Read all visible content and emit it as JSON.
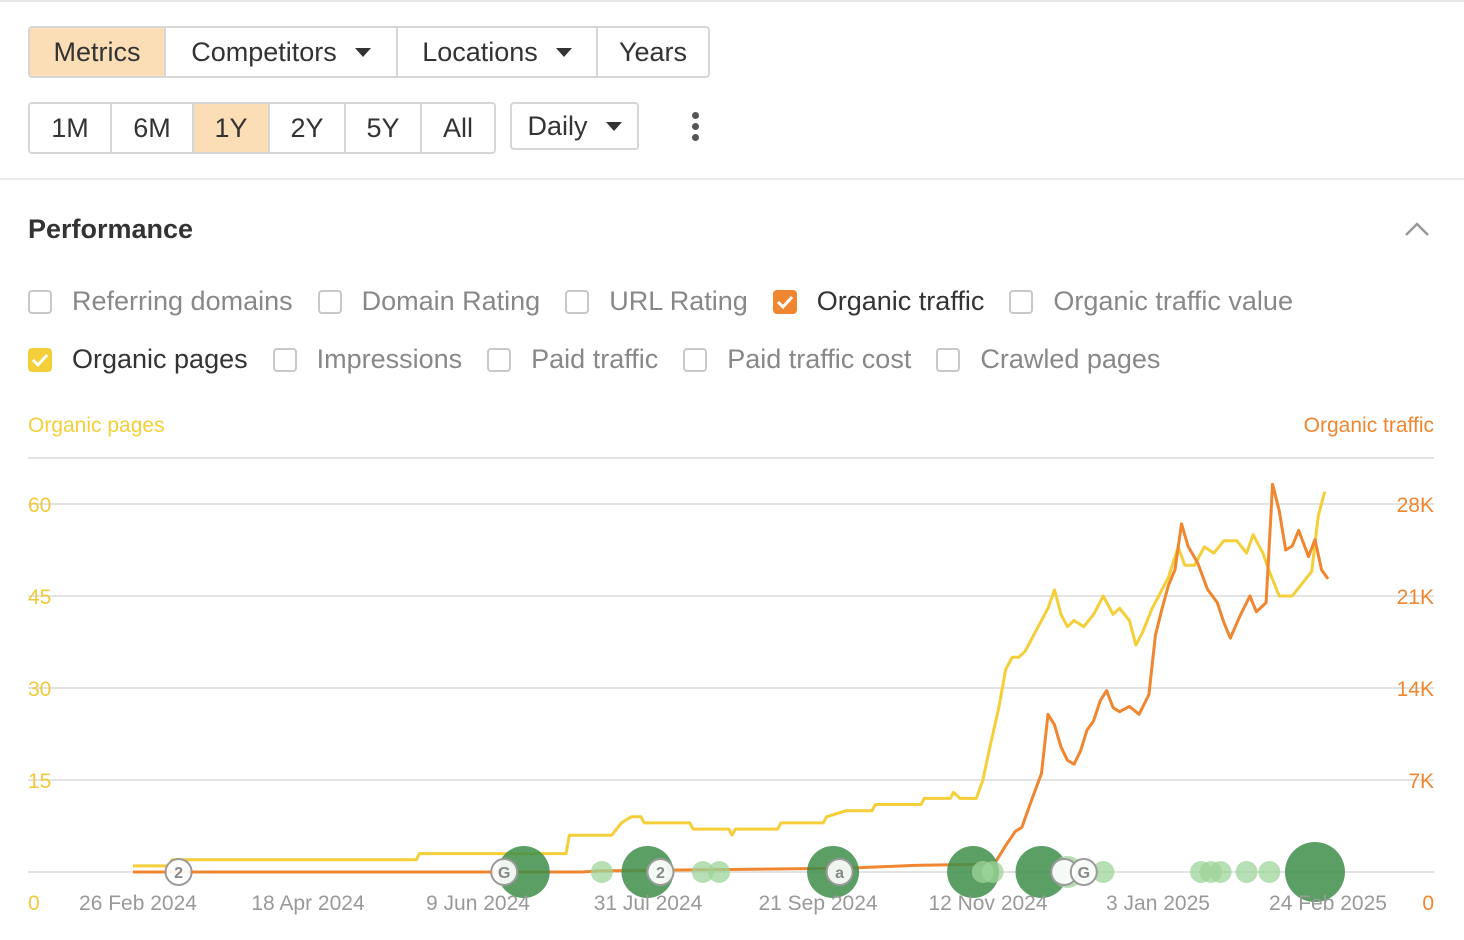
{
  "toolbar": {
    "view_tabs": [
      {
        "label": "Metrics",
        "active": true,
        "dropdown": false
      },
      {
        "label": "Competitors",
        "active": false,
        "dropdown": true
      },
      {
        "label": "Locations",
        "active": false,
        "dropdown": true
      },
      {
        "label": "Years",
        "active": false,
        "dropdown": false
      }
    ],
    "ranges": [
      {
        "label": "1M",
        "active": false
      },
      {
        "label": "6M",
        "active": false
      },
      {
        "label": "1Y",
        "active": true
      },
      {
        "label": "2Y",
        "active": false
      },
      {
        "label": "5Y",
        "active": false
      },
      {
        "label": "All",
        "active": false
      }
    ],
    "interval": "Daily"
  },
  "section": {
    "title": "Performance"
  },
  "metrics_row1": [
    {
      "label": "Referring domains",
      "checked": false
    },
    {
      "label": "Domain Rating",
      "checked": false
    },
    {
      "label": "URL Rating",
      "checked": false
    },
    {
      "label": "Organic traffic",
      "checked": true,
      "color": "#f0862f"
    },
    {
      "label": "Organic traffic value",
      "checked": false
    }
  ],
  "metrics_row2": [
    {
      "label": "Organic pages",
      "checked": true,
      "color": "#f4cf3a"
    },
    {
      "label": "Impressions",
      "checked": false
    },
    {
      "label": "Paid traffic",
      "checked": false
    },
    {
      "label": "Paid traffic cost",
      "checked": false
    },
    {
      "label": "Crawled pages",
      "checked": false
    }
  ],
  "colors": {
    "organic_pages": "#f4cf3a",
    "organic_traffic": "#f0862f",
    "marker_green": "#3e8e4a",
    "marker_light": "#9ed49a"
  },
  "chart_data": {
    "type": "line",
    "left_axis": {
      "label": "Organic pages",
      "ticks": [
        "0",
        "15",
        "30",
        "45",
        "60"
      ],
      "ylim": [
        0,
        67.5
      ]
    },
    "right_axis": {
      "label": "Organic traffic",
      "ticks": [
        "0",
        "7K",
        "14K",
        "21K",
        "28K"
      ],
      "ylim": [
        0,
        31500
      ]
    },
    "x_ticks": [
      "26 Feb 2024",
      "18 Apr 2024",
      "9 Jun 2024",
      "31 Jul 2024",
      "21 Sep 2024",
      "12 Nov 2024",
      "3 Jan 2025",
      "24 Feb 2025"
    ],
    "x_range": [
      "2024-02-23",
      "2025-02-24"
    ],
    "grid": true,
    "series": [
      {
        "name": "Organic pages",
        "axis": "left",
        "points": [
          [
            "2024-02-23",
            1
          ],
          [
            "2024-03-05",
            1
          ],
          [
            "2024-03-06",
            2
          ],
          [
            "2024-05-20",
            2
          ],
          [
            "2024-05-21",
            3
          ],
          [
            "2024-07-05",
            3
          ],
          [
            "2024-07-06",
            6
          ],
          [
            "2024-07-19",
            6
          ],
          [
            "2024-07-22",
            8
          ],
          [
            "2024-07-25",
            9
          ],
          [
            "2024-07-28",
            9
          ],
          [
            "2024-07-29",
            8
          ],
          [
            "2024-08-12",
            8
          ],
          [
            "2024-08-13",
            7
          ],
          [
            "2024-08-24",
            7
          ],
          [
            "2024-08-25",
            6
          ],
          [
            "2024-08-26",
            7
          ],
          [
            "2024-09-08",
            7
          ],
          [
            "2024-09-09",
            8
          ],
          [
            "2024-09-22",
            8
          ],
          [
            "2024-09-23",
            9
          ],
          [
            "2024-09-29",
            10
          ],
          [
            "2024-10-07",
            10
          ],
          [
            "2024-10-08",
            11
          ],
          [
            "2024-10-22",
            11
          ],
          [
            "2024-10-23",
            12
          ],
          [
            "2024-10-31",
            12
          ],
          [
            "2024-11-01",
            13
          ],
          [
            "2024-11-03",
            12
          ],
          [
            "2024-11-08",
            12
          ],
          [
            "2024-11-10",
            15
          ],
          [
            "2024-11-12",
            20
          ],
          [
            "2024-11-15",
            27
          ],
          [
            "2024-11-17",
            33
          ],
          [
            "2024-11-19",
            35
          ],
          [
            "2024-11-21",
            35
          ],
          [
            "2024-11-23",
            36
          ],
          [
            "2024-11-26",
            39
          ],
          [
            "2024-11-28",
            41
          ],
          [
            "2024-11-30",
            43
          ],
          [
            "2024-12-02",
            46
          ],
          [
            "2024-12-04",
            42
          ],
          [
            "2024-12-06",
            40
          ],
          [
            "2024-12-08",
            41
          ],
          [
            "2024-12-11",
            40
          ],
          [
            "2024-12-14",
            42
          ],
          [
            "2024-12-17",
            45
          ],
          [
            "2024-12-20",
            42
          ],
          [
            "2024-12-22",
            43
          ],
          [
            "2024-12-25",
            41
          ],
          [
            "2024-12-27",
            37
          ],
          [
            "2024-12-29",
            39
          ],
          [
            "2025-01-01",
            43
          ],
          [
            "2025-01-03",
            45
          ],
          [
            "2025-01-06",
            48
          ],
          [
            "2025-01-09",
            53
          ],
          [
            "2025-01-11",
            50
          ],
          [
            "2025-01-14",
            50
          ],
          [
            "2025-01-17",
            53
          ],
          [
            "2025-01-20",
            52
          ],
          [
            "2025-01-23",
            54
          ],
          [
            "2025-01-27",
            54
          ],
          [
            "2025-01-30",
            52
          ],
          [
            "2025-02-01",
            55
          ],
          [
            "2025-02-04",
            52
          ],
          [
            "2025-02-06",
            49
          ],
          [
            "2025-02-09",
            45
          ],
          [
            "2025-02-13",
            45
          ],
          [
            "2025-02-16",
            47
          ],
          [
            "2025-02-19",
            49
          ],
          [
            "2025-02-21",
            58
          ],
          [
            "2025-02-23",
            62
          ]
        ]
      },
      {
        "name": "Organic traffic",
        "axis": "right",
        "points": [
          [
            "2024-02-23",
            0
          ],
          [
            "2024-07-10",
            0
          ],
          [
            "2024-07-15",
            80
          ],
          [
            "2024-09-30",
            300
          ],
          [
            "2024-10-20",
            500
          ],
          [
            "2024-11-11",
            600
          ],
          [
            "2024-11-14",
            800
          ],
          [
            "2024-11-17",
            2000
          ],
          [
            "2024-11-20",
            3100
          ],
          [
            "2024-11-22",
            3400
          ],
          [
            "2024-11-25",
            5500
          ],
          [
            "2024-11-28",
            7500
          ],
          [
            "2024-11-30",
            12000
          ],
          [
            "2024-12-02",
            11200
          ],
          [
            "2024-12-04",
            9500
          ],
          [
            "2024-12-06",
            8500
          ],
          [
            "2024-12-08",
            8200
          ],
          [
            "2024-12-10",
            9200
          ],
          [
            "2024-12-12",
            10800
          ],
          [
            "2024-12-14",
            11500
          ],
          [
            "2024-12-16",
            13000
          ],
          [
            "2024-12-18",
            13800
          ],
          [
            "2024-12-20",
            12500
          ],
          [
            "2024-12-22",
            12200
          ],
          [
            "2024-12-25",
            12600
          ],
          [
            "2024-12-28",
            12000
          ],
          [
            "2024-12-31",
            13500
          ],
          [
            "2025-01-02",
            18000
          ],
          [
            "2025-01-04",
            20000
          ],
          [
            "2025-01-06",
            21800
          ],
          [
            "2025-01-08",
            23000
          ],
          [
            "2025-01-10",
            26500
          ],
          [
            "2025-01-12",
            24800
          ],
          [
            "2025-01-15",
            23500
          ],
          [
            "2025-01-18",
            21500
          ],
          [
            "2025-01-21",
            20500
          ],
          [
            "2025-01-23",
            19000
          ],
          [
            "2025-01-25",
            17800
          ],
          [
            "2025-01-28",
            19500
          ],
          [
            "2025-01-31",
            21000
          ],
          [
            "2025-02-02",
            19800
          ],
          [
            "2025-02-05",
            20500
          ],
          [
            "2025-02-07",
            29500
          ],
          [
            "2025-02-09",
            27500
          ],
          [
            "2025-02-11",
            24500
          ],
          [
            "2025-02-13",
            24800
          ],
          [
            "2025-02-15",
            26000
          ],
          [
            "2025-02-18",
            24000
          ],
          [
            "2025-02-20",
            25300
          ],
          [
            "2025-02-22",
            23000
          ],
          [
            "2025-02-24",
            22300
          ]
        ]
      }
    ],
    "annotations": [
      {
        "date": "2024-03-08",
        "kind": "badge",
        "text": "2"
      },
      {
        "date": "2024-06-16",
        "kind": "badge",
        "text": "G"
      },
      {
        "date": "2024-08-03",
        "kind": "badge",
        "text": "2"
      },
      {
        "date": "2024-09-27",
        "kind": "badge",
        "text": "a"
      },
      {
        "date": "2024-12-05",
        "kind": "badge",
        "text": ""
      },
      {
        "date": "2024-12-11",
        "kind": "badge",
        "text": "G"
      },
      {
        "date": "2024-06-22",
        "kind": "dot",
        "size": "large"
      },
      {
        "date": "2024-07-16",
        "kind": "dot",
        "size": "small"
      },
      {
        "date": "2024-07-30",
        "kind": "dot",
        "size": "large"
      },
      {
        "date": "2024-08-02",
        "kind": "dot",
        "size": "small"
      },
      {
        "date": "2024-08-16",
        "kind": "dot",
        "size": "small"
      },
      {
        "date": "2024-08-21",
        "kind": "dot",
        "size": "small"
      },
      {
        "date": "2024-09-25",
        "kind": "dot",
        "size": "large"
      },
      {
        "date": "2024-11-07",
        "kind": "dot",
        "size": "large"
      },
      {
        "date": "2024-11-10",
        "kind": "dot",
        "size": "small"
      },
      {
        "date": "2024-11-13",
        "kind": "dot",
        "size": "small"
      },
      {
        "date": "2024-11-28",
        "kind": "dot",
        "size": "large"
      },
      {
        "date": "2024-12-06",
        "kind": "dot",
        "size": "medium"
      },
      {
        "date": "2024-12-12",
        "kind": "dot",
        "size": "small"
      },
      {
        "date": "2024-12-17",
        "kind": "dot",
        "size": "small"
      },
      {
        "date": "2025-01-16",
        "kind": "dot",
        "size": "small"
      },
      {
        "date": "2025-01-19",
        "kind": "dot",
        "size": "small"
      },
      {
        "date": "2025-01-22",
        "kind": "dot",
        "size": "small"
      },
      {
        "date": "2025-01-30",
        "kind": "dot",
        "size": "small"
      },
      {
        "date": "2025-02-06",
        "kind": "dot",
        "size": "small"
      },
      {
        "date": "2025-02-20",
        "kind": "dot",
        "size": "xlarge"
      }
    ]
  }
}
